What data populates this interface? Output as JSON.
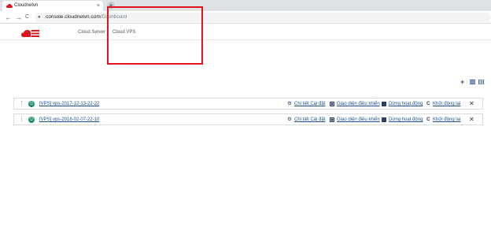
{
  "browser": {
    "tab_title": "Cloudnetvn",
    "tab_close": "×",
    "new_tab": "+",
    "back": "←",
    "forward": "→",
    "reload": "C",
    "url_host": "console.cloudnetvn.com",
    "url_path": "/Dashboard"
  },
  "nav": {
    "items": [
      {
        "label": "Cloud Server"
      },
      {
        "label": "Cloud VPS"
      }
    ]
  },
  "colors": {
    "accent": "#1a4f8c",
    "brand": "#e0141e",
    "power_on": "#1f8a6e"
  },
  "toolbar_icons": [
    "add-icon",
    "list-view-icon",
    "grid-view-icon"
  ],
  "vps_rows": [
    {
      "name": "[VPS] vps-2017-12-13-22-22",
      "actions": {
        "settings": "Chi tiết Cài đặt",
        "console": "Giao diện điều khiển",
        "stop": "Dừng hoạt động",
        "restart": "Khởi động lại"
      }
    },
    {
      "name": "[VPS] vps-2018-02-07-22-10",
      "actions": {
        "settings": "Chi tiết Cài đặt",
        "console": "Giao diện điều khiển",
        "stop": "Dừng hoạt động",
        "restart": "Khởi động lại"
      }
    }
  ]
}
